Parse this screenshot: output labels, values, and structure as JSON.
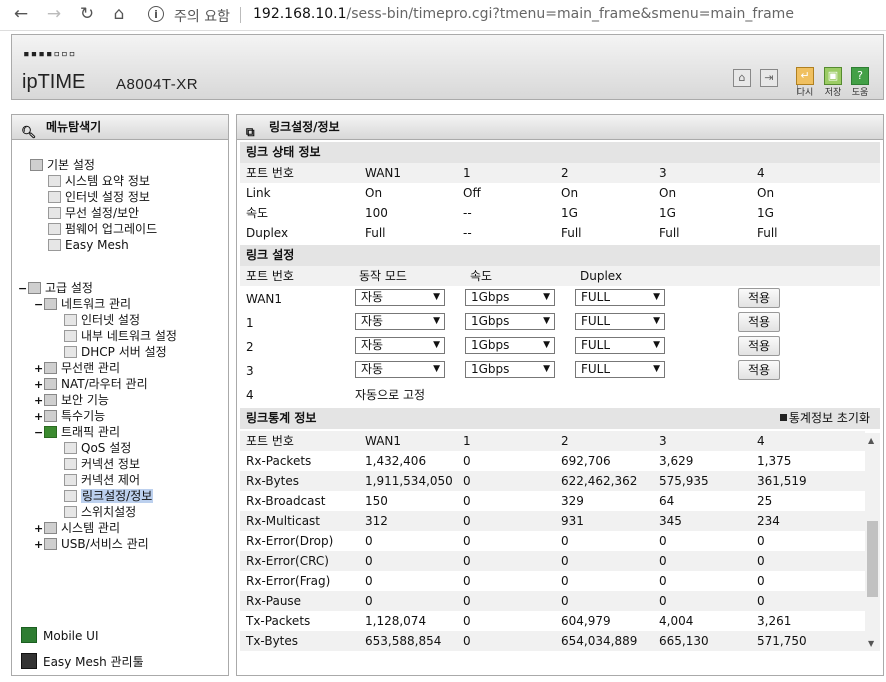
{
  "browser": {
    "security_label": "주의 요함",
    "url_host": "192.168.10.1",
    "url_path": "/sess-bin/timepro.cgi?tmenu=main_frame&smenu=main_frame"
  },
  "header": {
    "brand": "ipTIME",
    "model": "A8004T-XR",
    "buttons": [
      {
        "label": "다시"
      },
      {
        "label": "저장"
      },
      {
        "label": "도움"
      }
    ]
  },
  "left": {
    "title": "메뉴탐색기",
    "basic": {
      "label": "기본 설정",
      "items": [
        "시스템 요약 정보",
        "인터넷 설정 정보",
        "무선 설정/보안",
        "펌웨어 업그레이드",
        "Easy Mesh"
      ]
    },
    "advanced": {
      "label": "고급 설정",
      "network": {
        "label": "네트워크 관리",
        "items": [
          "인터넷 설정",
          "내부 네트워크 설정",
          "DHCP 서버 설정"
        ]
      },
      "wireless": "무선랜 관리",
      "nat": "NAT/라우터 관리",
      "security": "보안 기능",
      "special": "특수기능",
      "traffic": {
        "label": "트래픽 관리",
        "items": [
          "QoS 설정",
          "커넥션 정보",
          "커넥션 제어",
          "링크설정/정보",
          "스위치설정"
        ]
      },
      "system": "시스템 관리",
      "usb": "USB/서비스 관리"
    },
    "mobile_ui": "Mobile UI",
    "easymesh_mgmt": "Easy Mesh 관리툴"
  },
  "right": {
    "title": "링크설정/정보",
    "status": {
      "title": "링크 상태 정보",
      "header": [
        "포트 번호",
        "WAN1",
        "1",
        "2",
        "3",
        "4"
      ],
      "rows": [
        [
          "Link",
          "On",
          "Off",
          "On",
          "On",
          "On"
        ],
        [
          "속도",
          "100",
          "--",
          "1G",
          "1G",
          "1G"
        ],
        [
          "Duplex",
          "Full",
          "--",
          "Full",
          "Full",
          "Full"
        ]
      ]
    },
    "config": {
      "title": "링크 설정",
      "header": [
        "포트 번호",
        "동작 모드",
        "속도",
        "Duplex"
      ],
      "rows": [
        {
          "port": "WAN1",
          "mode": "자동",
          "speed": "1Gbps",
          "duplex": "FULL",
          "apply": "적용"
        },
        {
          "port": "1",
          "mode": "자동",
          "speed": "1Gbps",
          "duplex": "FULL",
          "apply": "적용"
        },
        {
          "port": "2",
          "mode": "자동",
          "speed": "1Gbps",
          "duplex": "FULL",
          "apply": "적용"
        },
        {
          "port": "3",
          "mode": "자동",
          "speed": "1Gbps",
          "duplex": "FULL",
          "apply": "적용"
        }
      ],
      "fixed_port": "4",
      "fixed_text": "자동으로 고정"
    },
    "stats": {
      "title": "링크통계 정보",
      "reset_label": "통계정보 초기화",
      "header": [
        "포트 번호",
        "WAN1",
        "1",
        "2",
        "3",
        "4"
      ],
      "rows": [
        [
          "Rx-Packets",
          "1,432,406",
          "0",
          "692,706",
          "3,629",
          "1,375"
        ],
        [
          "Rx-Bytes",
          "1,911,534,050",
          "0",
          "622,462,362",
          "575,935",
          "361,519"
        ],
        [
          "Rx-Broadcast",
          "150",
          "0",
          "329",
          "64",
          "25"
        ],
        [
          "Rx-Multicast",
          "312",
          "0",
          "931",
          "345",
          "234"
        ],
        [
          "Rx-Error(Drop)",
          "0",
          "0",
          "0",
          "0",
          "0"
        ],
        [
          "Rx-Error(CRC)",
          "0",
          "0",
          "0",
          "0",
          "0"
        ],
        [
          "Rx-Error(Frag)",
          "0",
          "0",
          "0",
          "0",
          "0"
        ],
        [
          "Rx-Pause",
          "0",
          "0",
          "0",
          "0",
          "0"
        ],
        [
          "Tx-Packets",
          "1,128,074",
          "0",
          "604,979",
          "4,004",
          "3,261"
        ],
        [
          "Tx-Bytes",
          "653,588,854",
          "0",
          "654,034,889",
          "665,130",
          "571,750"
        ]
      ]
    }
  }
}
